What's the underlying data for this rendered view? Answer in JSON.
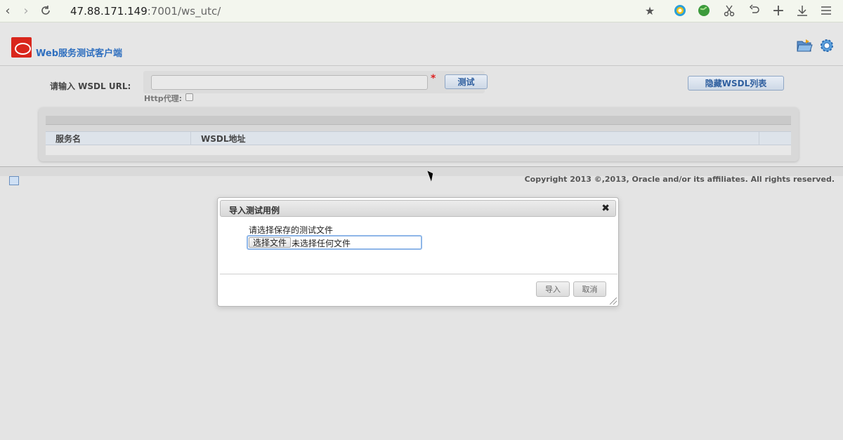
{
  "browser": {
    "url_host": "47.88.171.149",
    "url_rest": ":7001/ws_utc/",
    "icons": [
      "back-icon",
      "forward-icon",
      "reload-icon",
      "bookmark-star-icon",
      "extension-icon",
      "globe-icon",
      "scissors-icon",
      "undo-icon",
      "new-tab-icon",
      "download-icon",
      "menu-icon"
    ]
  },
  "header": {
    "title": "Web服务测试客户端",
    "icons": [
      "open-folder-icon",
      "settings-gear-icon"
    ]
  },
  "wsdl_form": {
    "label": "请输入 WSDL URL:",
    "url_value": "",
    "required_mark": "*",
    "test_button": "测试",
    "proxy_label": "Http代理:",
    "hide_list_button": "隐藏WSDL列表"
  },
  "wsdl_table": {
    "columns": [
      "服务名",
      "WSDL地址"
    ],
    "rows": []
  },
  "footer": {
    "copyright": "Copyright 2013 ©,2013, Oracle and/or its affiliates. All rights reserved."
  },
  "dialog": {
    "title": "导入测试用例",
    "close_glyph": "✖",
    "prompt": "请选择保存的测试文件",
    "choose_file_button": "选择文件",
    "file_status": "未选择任何文件",
    "import_button": "导入",
    "cancel_button": "取消"
  },
  "colors": {
    "oracle_red": "#d9261c",
    "title_blue": "#2f6fbf",
    "required_red": "#dd2222",
    "focus_blue": "#8eb6e8"
  }
}
